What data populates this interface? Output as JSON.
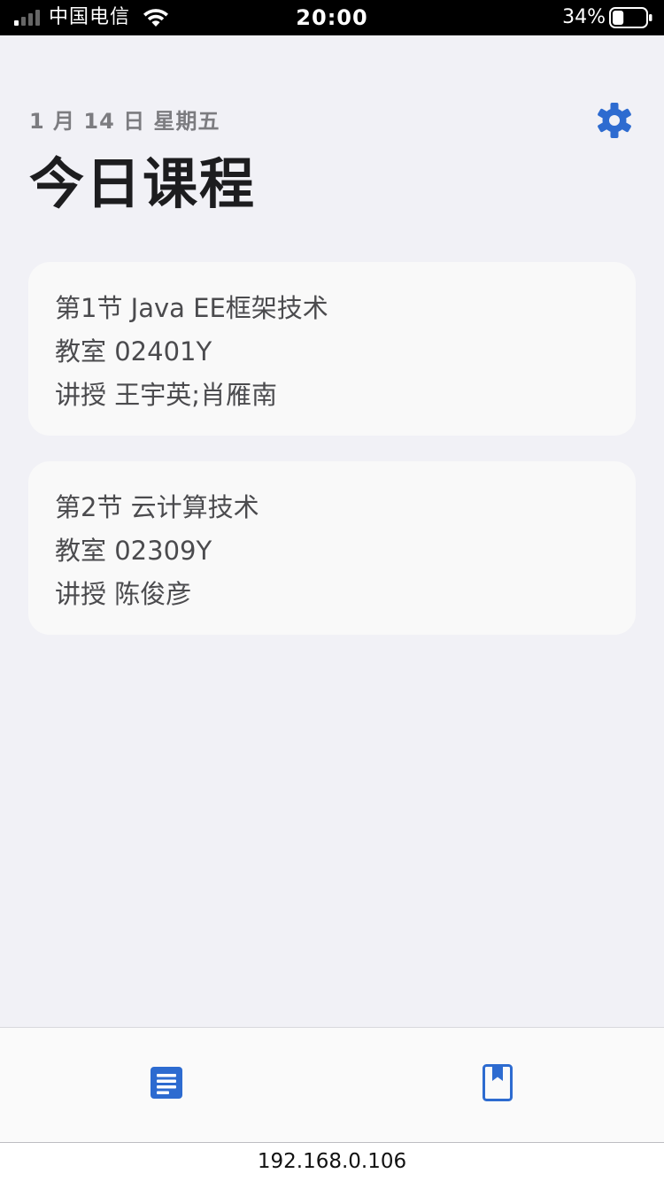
{
  "status_bar": {
    "carrier": "中国电信",
    "time": "20:00",
    "battery_percent": "34%",
    "battery_level": 0.34,
    "signal_bars_active": 1,
    "signal_bars_total": 4,
    "icons": [
      "signal-icon",
      "wifi-icon",
      "battery-icon"
    ]
  },
  "header": {
    "date": "1 月 14 日 星期五",
    "title": "今日课程",
    "settings_icon": "gear-icon"
  },
  "courses": [
    {
      "period": "第1节 Java EE框架技术",
      "room": "教室 02401Y",
      "teacher": "讲授 王宇英;肖雁南"
    },
    {
      "period": "第2节 云计算技术",
      "room": "教室 02309Y",
      "teacher": "讲授 陈俊彦"
    }
  ],
  "tab_bar": {
    "tabs": [
      {
        "icon": "document-icon",
        "active": true
      },
      {
        "icon": "bookmark-icon",
        "active": false
      }
    ]
  },
  "url_bar": {
    "url": "192.168.0.106"
  },
  "colors": {
    "accent": "#2d6bd0",
    "background": "#f1f1f6",
    "card": "#f9f9f9",
    "muted_text": "#7c7c80"
  }
}
